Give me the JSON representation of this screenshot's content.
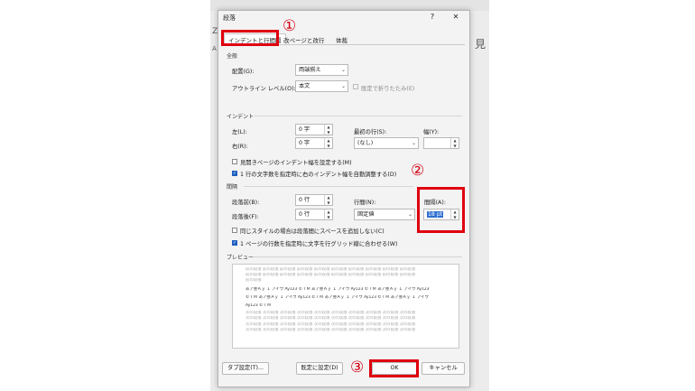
{
  "background_doc": {
    "left_chars": [
      "Z",
      "A"
    ],
    "right_char": "見"
  },
  "dialog": {
    "title": "段落",
    "help_label": "?",
    "close_label": "✕",
    "tabs": [
      {
        "label": "インデントと行間隔"
      },
      {
        "label": "改ページと改行"
      },
      {
        "label": "体裁"
      }
    ],
    "general": {
      "section_label": "全般",
      "alignment_label": "配置(G):",
      "alignment_value": "両端揃え",
      "outline_label": "アウトライン レベル(O):",
      "outline_value": "本文",
      "collapsed_label": "既定で折りたたみ(E)"
    },
    "indent": {
      "section_label": "インデント",
      "left_label": "左(L):",
      "left_value": "0 字",
      "right_label": "右(R):",
      "right_value": "0 字",
      "first_line_label": "最初の行(S):",
      "first_line_value": "(なし)",
      "width_label": "幅(Y):",
      "width_value": "",
      "mirror_label": "見開きページのインデント幅を設定する(M)",
      "mirror_checked": false,
      "auto_adjust_label": "1 行の文字数を指定時に右のインデント幅を自動調整する(D)",
      "auto_adjust_checked": true
    },
    "spacing": {
      "section_label": "間隔",
      "before_label": "段落前(B):",
      "before_value": "0 行",
      "after_label": "段落後(F):",
      "after_value": "0 行",
      "line_spacing_label": "行間(N):",
      "line_spacing_value": "固定値",
      "at_label": "間隔(A):",
      "at_value": "18 pt",
      "no_space_label": "同じスタイルの場合は段落間にスペースを追加しない(C)",
      "no_space_checked": false,
      "grid_label": "1 ページの行数を指定時に文字を行グリッド線に合わせる(W)",
      "grid_checked": true
    },
    "preview": {
      "section_label": "プレビュー",
      "before_lines": [
        "前の段落 前の段落 前の段落 前の段落 前の段落 前の段落 前の段落 前の段落 前の段落 前の段落",
        "前の段落 前の段落 前の段落 前の段落 前の段落 前の段落 前の段落 前の段落 前の段落 前の段落",
        "前の段落"
      ],
      "sample_lines": [
        "あア亜Ａｙ １ アイウ Ay123 ©ＴＭ あア亜Ａｙ １ アイウ Ay123 ©ＴＭ あア亜Ａｙ １ アイウ Ay123",
        "©ＴＭ あア亜Ａｙ １ アイウ Ay123 ©ＴＭ あア亜Ａｙ １ アイウ Ay123 ©ＴＭ あア亜Ａｙ １ アイウ",
        "Ay123 ©ＴＭ"
      ],
      "after_lines": [
        "次の段落 次の段落 次の段落 次の段落 次の段落 次の段落 次の段落 次の段落 次の段落 次の段落",
        "次の段落 次の段落 次の段落 次の段落 次の段落 次の段落 次の段落 次の段落 次の段落 次の段落",
        "次の段落 次の段落 次の段落 次の段落 次の段落 次の段落 次の段落 次の段落 次の段落 次の段落",
        "次の段落 次の段落 次の段落 次の段落 次の段落 次の段落 次の段落 次の段落 次の段落 次の段落"
      ]
    },
    "buttons": {
      "tabs_label": "タブ設定(T)...",
      "default_label": "既定に設定(D)",
      "ok_label": "OK",
      "cancel_label": "キャンセル"
    }
  },
  "annotations": {
    "marker_1": "①",
    "marker_2": "②",
    "marker_3": "③",
    "highlight_color": "#e0000e"
  }
}
